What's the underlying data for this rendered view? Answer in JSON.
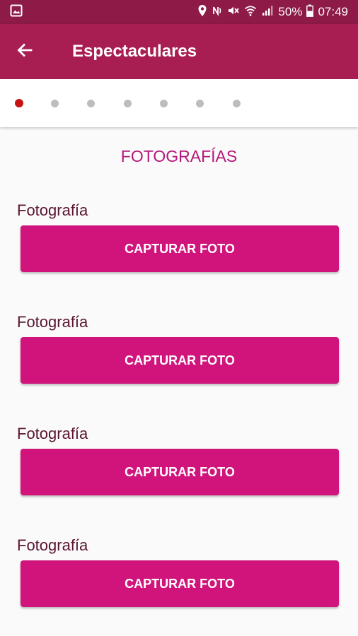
{
  "status_bar": {
    "battery": "50%",
    "time": "07:49",
    "icons": [
      "image-icon",
      "location-icon",
      "nfc-icon",
      "mute-icon",
      "wifi-icon",
      "signal-icon",
      "battery-icon"
    ]
  },
  "app_bar": {
    "title": "Espectaculares",
    "back_icon": "arrow-back-icon"
  },
  "stepper": {
    "total_steps": 7,
    "active_step": 1
  },
  "section": {
    "title": "FOTOGRAFÍAS"
  },
  "photos": [
    {
      "label": "Fotografía",
      "button": "CAPTURAR FOTO"
    },
    {
      "label": "Fotografía",
      "button": "CAPTURAR FOTO"
    },
    {
      "label": "Fotografía",
      "button": "CAPTURAR FOTO"
    },
    {
      "label": "Fotografía",
      "button": "CAPTURAR FOTO"
    }
  ],
  "colors": {
    "status_bar": "#8d1a47",
    "app_bar": "#a81e52",
    "accent": "#d0147c",
    "section_title": "#b5177a",
    "active_dot": "#c41414"
  }
}
